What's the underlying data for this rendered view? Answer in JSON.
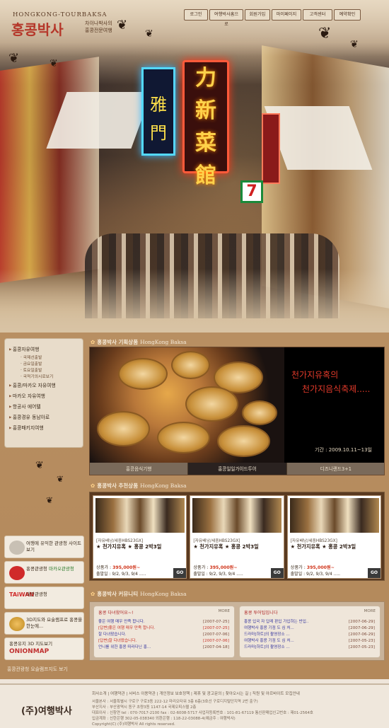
{
  "header": {
    "logo_en": "HONGKONG-TOURBAKSA",
    "logo_ko": "홍콩박사",
    "logo_sub1": "차이나박사의",
    "logo_sub2": "홍콩전문여행",
    "nav": [
      "로그인",
      "여행박사홈으로",
      "회원가입",
      "마이페이지",
      "고객센터",
      "예약확인"
    ],
    "hero_signs": {
      "red": "力 新 菜 館",
      "blue": "雅 門",
      "seven": "7"
    }
  },
  "sidebar": {
    "menu": [
      {
        "label": "홍콩자유여행",
        "sub": [
          "국제선출발",
          "금요일출발",
          "토요일출발",
          "국적기의시로보기"
        ]
      },
      {
        "label": "홍콩/마카오 자유여행",
        "sub": []
      },
      {
        "label": "마카오 자유여행",
        "sub": []
      },
      {
        "label": "항공사 에어텔",
        "sub": []
      },
      {
        "label": "홍콩경유 동남아로",
        "sub": []
      },
      {
        "label": "홍콩패키지여행",
        "sub": []
      }
    ],
    "banners": [
      {
        "label": "여행에 유익한 관광청 사이트보기",
        "colors": "#8a8a8a"
      },
      {
        "label": "홍콩관광청",
        "extra": "마카오관광청",
        "color": "#d02a2a"
      },
      {
        "label": "대만관광청",
        "brand": "TAiWAN",
        "color": "#d02a2a"
      },
      {
        "label": "3D지도와 요술램프로 홍콩을 한눈에...",
        "color": "#d09a2a"
      },
      {
        "label": "홍콩유지 3D 지도보기",
        "brand": "ONIONMAP",
        "color": "#c03030"
      }
    ],
    "bottom_text": "홍콩관광청 요술램프지도 보기"
  },
  "featured": {
    "heading": "홍콩박사 기획상품",
    "heading_en": "HongKong Baksa",
    "title1": "천가지유혹의",
    "title2": "천가지음식축제.....",
    "date": "기간 : 2009.10.11~13일",
    "tabs": [
      "홍콩음식기행",
      "홍콩일일가이드투어",
      "디즈니랜드3+1"
    ]
  },
  "recommended": {
    "heading": "홍콩박사 추천상품",
    "heading_en": "HongKong Baksa",
    "cards": [
      {
        "code": "[자유배낭/세중HBS23GX]",
        "name": "★ 천가지유혹 ★ 홍콩 2박3일",
        "price_label": "상품가 : ",
        "price": "395,000원~",
        "dates": "출발일 : 9/2, 9/3, 9/4 .....",
        "go": "GO"
      },
      {
        "code": "[자유배낭/세중HBS23GX]",
        "name": "★ 천가지유혹 ★ 홍콩 2박3일",
        "price_label": "상품가 : ",
        "price": "395,000원~",
        "dates": "출발일 : 9/2, 9/3, 9/4 .....",
        "go": "GO"
      },
      {
        "code": "[자유배낭/세중HBS23GX]",
        "name": "★ 천가지유혹 ★ 홍콩 2박3일",
        "price_label": "상품가 : ",
        "price": "395,000원~",
        "dates": "출발일 : 9/2, 9/3, 9/4 .....",
        "go": "GO"
      }
    ]
  },
  "community": {
    "heading": "홍콩박사 커뮤니티",
    "heading_en": "HongKong Baksa",
    "left": {
      "title": "홍콩 다녀왔어요~!",
      "more": "MORE",
      "rows": [
        {
          "t": "좋은 여행 매우 만족 합니다.",
          "d": "[2007-07-25]",
          "red": false
        },
        {
          "t": "[답변]좋은 여행 매우 만족 합니다.",
          "d": "[2007-07-25]",
          "red": true
        },
        {
          "t": "잘 다녀왔습니다.",
          "d": "[2007-07-06]",
          "red": false
        },
        {
          "t": "[답변]잘 다녀왔습니다.",
          "d": "[2007-07-06]",
          "red": true
        },
        {
          "t": "언니를 위한 홍콩 따라다닌 홍...",
          "d": "[2007-04-18]",
          "red": false
        }
      ]
    },
    "right": {
      "title": "홍콩 투어팁입니다",
      "more": "MORE",
      "rows": [
        {
          "t": "홍콩 입국 자 답례 판입 가입하는 반입..",
          "d": "[2007-06-29]",
          "red": false
        },
        {
          "t": "여행박사 홍콩 기점 도 심 처...",
          "d": "[2007-06-29]",
          "red": false
        },
        {
          "t": "드라마[하트]의 촬영장소 ...",
          "d": "[2007-06-29]",
          "red": false
        },
        {
          "t": "여행박사 홍콩 기점 도 심 처...",
          "d": "[2007-05-23]",
          "red": false
        },
        {
          "t": "드라마[하트]의 촬영장소 ...",
          "d": "[2007-05-23]",
          "red": false
        }
      ]
    }
  },
  "footer": {
    "logo": "(주)여행박사",
    "links": "회사소개 | 여행약관 | 서비스 이용약관 | 개인정보 보호정책 | 제휴 및 광고문의 | 찾아오시는 길 | 직원 및 아르바이트 모집안내",
    "lines": [
      "서울본사 : 서울특별시 구로구 구로3동 222-12 마리오타워 3층 6층(3호선 구로디지털단지역 2번 출구)",
      "부산지사 : 부산광역시 동구 초량3동 1147-14 국제오피스텔 2층",
      "대표이사 : 신창연  tel : 070-7017-2100 fax : 02-6008-5717  사업자등록번호 : 101-81-67119  통신판매업신고번호 : 제01-2564호",
      "입금계좌 : 신한은행 302-05-038340  외환은행 : 118-22-03088-4(예금주 : 여행박사)",
      "Copyright(C) (주)여행박사 All rights reserved."
    ]
  }
}
